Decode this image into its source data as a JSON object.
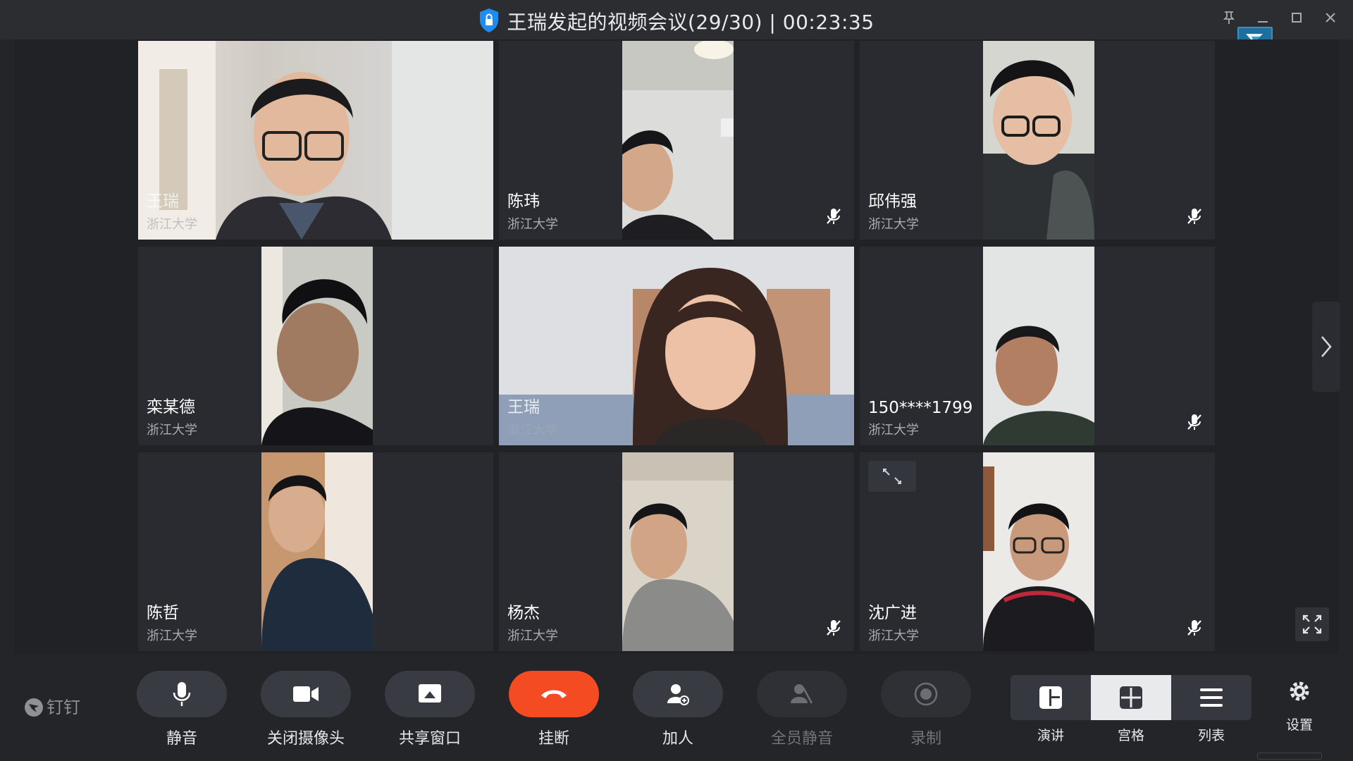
{
  "window": {
    "title": "王瑞发起的视频会议(29/30) | 00:23:35"
  },
  "participants": [
    {
      "name": "王瑞",
      "org": "浙江大学",
      "video": "full",
      "muted": false,
      "scene": "man-glasses-room"
    },
    {
      "name": "陈玮",
      "org": "浙江大学",
      "video": "mid",
      "muted": true,
      "scene": "man-ceiling"
    },
    {
      "name": "邱伟强",
      "org": "浙江大学",
      "video": "mid",
      "muted": true,
      "scene": "boy-glasses"
    },
    {
      "name": "栾某德",
      "org": "浙江大学",
      "video": "mid",
      "muted": false,
      "scene": "man-head-down"
    },
    {
      "name": "王瑞",
      "org": "浙江大学",
      "video": "full",
      "muted": false,
      "scene": "woman-room"
    },
    {
      "name": "150****1799",
      "org": "浙江大学",
      "video": "mid",
      "muted": true,
      "scene": "man-white-wall"
    },
    {
      "name": "陈哲",
      "org": "浙江大学",
      "video": "mid",
      "muted": false,
      "scene": "man-glasses-curtain"
    },
    {
      "name": "杨杰",
      "org": "浙江大学",
      "video": "mid",
      "muted": true,
      "scene": "man-glasses-sweater"
    },
    {
      "name": "沈广进",
      "org": "浙江大学",
      "video": "mid",
      "muted": true,
      "scene": "man-glasses-hoodie"
    }
  ],
  "toolbar": {
    "brand": "钉钉",
    "mute": "静音",
    "camera": "关闭摄像头",
    "share": "共享窗口",
    "hangup": "挂断",
    "add": "加人",
    "mute_all": "全员静音",
    "record": "录制",
    "view_speech": "演讲",
    "view_grid": "宫格",
    "view_list": "列表",
    "settings": "设置"
  },
  "colors": {
    "hangup": "#f44b22",
    "background": "#232529",
    "tile": "#292b30"
  }
}
